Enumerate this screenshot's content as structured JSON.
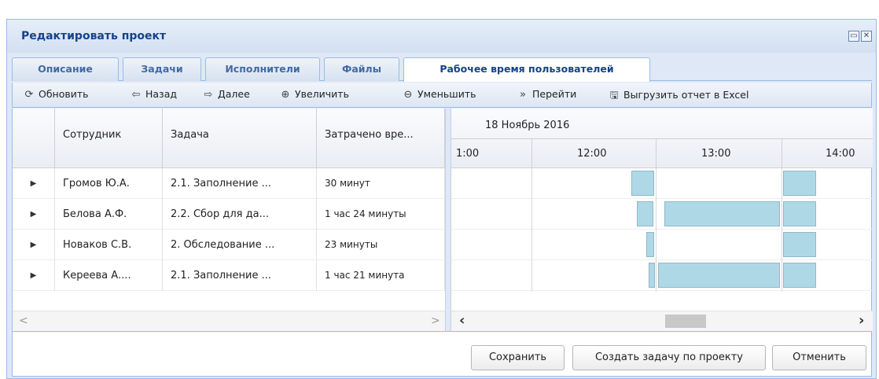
{
  "window": {
    "title": "Редактировать проект",
    "restore_glyph": "▭",
    "close_glyph": "✕"
  },
  "tabs": [
    {
      "label": "Описание"
    },
    {
      "label": "Задачи"
    },
    {
      "label": "Исполнители"
    },
    {
      "label": "Файлы"
    },
    {
      "label": "Рабочее время пользователей",
      "active": true
    }
  ],
  "toolbar": {
    "refresh": {
      "label": "Обновить",
      "icon": "refresh-icon",
      "glyph": "⟳"
    },
    "back": {
      "label": "Назад",
      "icon": "arrow-left-icon",
      "glyph": "⇦"
    },
    "forward": {
      "label": "Далее",
      "icon": "arrow-right-icon",
      "glyph": "⇨"
    },
    "zoom_in": {
      "label": "Увеличить",
      "icon": "zoom-in-icon",
      "glyph": "⊕"
    },
    "zoom_out": {
      "label": "Уменьшить",
      "icon": "zoom-out-icon",
      "glyph": "⊖"
    },
    "goto": {
      "label": "Перейти",
      "icon": "double-chevron-right-icon",
      "glyph": "»"
    },
    "export": {
      "label": "Выгрузить отчет в Excel",
      "icon": "floppy-disk-icon",
      "glyph": "🖫"
    }
  },
  "grid": {
    "columns": [
      "Сотрудник",
      "Задача",
      "Затрачено вре..."
    ],
    "rows": [
      {
        "employee": "Громов Ю.А.",
        "task": "2.1. Заполнение ...",
        "spent": "30 минут"
      },
      {
        "employee": "Белова А.Ф.",
        "task": "2.2. Сбор для да...",
        "spent": "1 час 24 минуты"
      },
      {
        "employee": "Новаков С.В.",
        "task": "2. Обследование ...",
        "spent": "23 минуты"
      },
      {
        "employee": "Кереева А....",
        "task": "2.1. Заполнение ...",
        "spent": "1 час 21 минута"
      }
    ],
    "expand_glyph": "▶"
  },
  "timeline": {
    "date": "18 Ноябрь 2016",
    "hours": [
      "1:00",
      "12:00",
      "13:00",
      "14:00"
    ]
  },
  "scroll": {
    "left_glyph": "<",
    "right_glyph": ">",
    "left_arrow_bold": "‹",
    "right_arrow_bold": "›"
  },
  "footer": {
    "save": "Сохранить",
    "create_task": "Создать задачу по проекту",
    "cancel": "Отменить"
  },
  "colors": {
    "bar": "#aed8e6",
    "title": "#15428b",
    "border": "#99bbe8"
  }
}
